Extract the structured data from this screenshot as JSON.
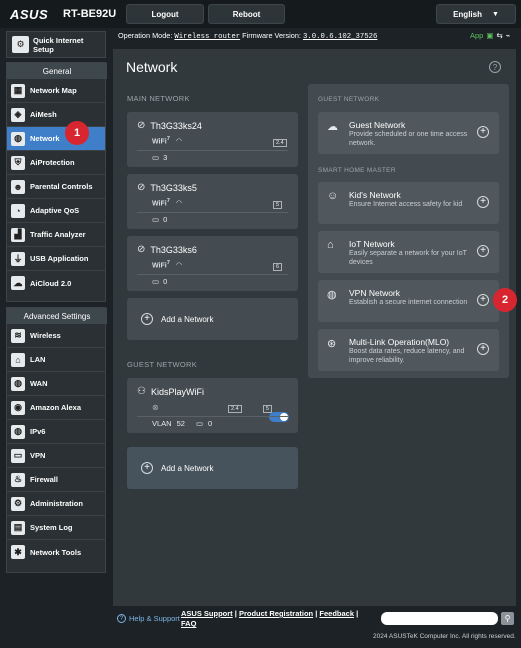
{
  "header": {
    "brand": "ASUS",
    "model": "RT-BE92U",
    "logout_label": "Logout",
    "reboot_label": "Reboot",
    "language": "English",
    "operation_mode_label": "Operation Mode:",
    "operation_mode_value": "Wireless router",
    "firmware_label": "Firmware Version:",
    "firmware_value": "3.0.0.6.102_37526",
    "app_label": "App"
  },
  "sidebar": {
    "quick_setup": "Quick Internet Setup",
    "general_label": "General",
    "general_items": [
      {
        "label": "Network Map",
        "icon": "network-map-icon"
      },
      {
        "label": "AiMesh",
        "icon": "aimesh-icon"
      },
      {
        "label": "Network",
        "icon": "network-globe-icon"
      },
      {
        "label": "AiProtection",
        "icon": "shield-icon"
      },
      {
        "label": "Parental Controls",
        "icon": "family-icon"
      },
      {
        "label": "Adaptive QoS",
        "icon": "gauge-icon"
      },
      {
        "label": "Traffic Analyzer",
        "icon": "chart-icon"
      },
      {
        "label": "USB Application",
        "icon": "usb-icon"
      },
      {
        "label": "AiCloud 2.0",
        "icon": "cloud-icon"
      }
    ],
    "advanced_label": "Advanced Settings",
    "advanced_items": [
      {
        "label": "Wireless",
        "icon": "wifi-icon"
      },
      {
        "label": "LAN",
        "icon": "house-icon"
      },
      {
        "label": "WAN",
        "icon": "globe-icon"
      },
      {
        "label": "Amazon Alexa",
        "icon": "alexa-icon"
      },
      {
        "label": "IPv6",
        "icon": "ipv6-globe-icon"
      },
      {
        "label": "VPN",
        "icon": "vpn-icon"
      },
      {
        "label": "Firewall",
        "icon": "flame-icon"
      },
      {
        "label": "Administration",
        "icon": "admin-gear-icon"
      },
      {
        "label": "System Log",
        "icon": "log-icon"
      },
      {
        "label": "Network Tools",
        "icon": "tools-icon"
      }
    ]
  },
  "main": {
    "title": "Network",
    "main_network_label": "MAIN NETWORK",
    "guest_network_label": "GUEST NETWORK",
    "networks": [
      {
        "name": "Th3G33ks24",
        "band": "2.4",
        "clients": "3"
      },
      {
        "name": "Th3G33ks5",
        "band": "5",
        "clients": "0"
      },
      {
        "name": "Th3G33ks6",
        "band": "6",
        "clients": "0"
      }
    ],
    "wifi_label": "WiFi",
    "wifi_gen": "7",
    "add_network_label": "Add a Network",
    "guest": {
      "name": "KidsPlayWiFi",
      "band_a": "2.4",
      "band_b": "5",
      "vlan_label": "VLAN",
      "vlan_value": "52",
      "clients": "0",
      "enabled": true
    }
  },
  "right": {
    "guest_section": "GUEST NETWORK",
    "smart_section": "SMART HOME MASTER",
    "cards": [
      {
        "title": "Guest Network",
        "desc": "Provide scheduled or one time access network.",
        "icon": "guest-cloud-icon"
      },
      {
        "title": "Kid's Network",
        "desc": "Ensure Internet access safety for kid",
        "icon": "kid-icon"
      },
      {
        "title": "IoT Network",
        "desc": "Easily separate a network for your IoT devices",
        "icon": "iot-house-icon"
      },
      {
        "title": "VPN Network",
        "desc": "Establish a secure internet connection",
        "icon": "vpn-globe-icon"
      },
      {
        "title": "Multi-Link Operation(MLO)",
        "desc": "Boost data rates, reduce latency, and improve reliability.",
        "icon": "mlo-icon"
      }
    ]
  },
  "annotations": {
    "badge1": "1",
    "badge2": "2",
    "badge_color": "#d7262f"
  },
  "footer": {
    "help_support": "Help & Support",
    "asus_support": "ASUS Support",
    "product_registration": "Product Registration",
    "feedback": "Feedback",
    "faq": "FAQ",
    "search_placeholder": "",
    "copyright": "2024 ASUSTeK Computer Inc. All rights reserved."
  },
  "colors": {
    "accent": "#3f7ec9",
    "panel": "#32393d",
    "card": "#444c51"
  }
}
